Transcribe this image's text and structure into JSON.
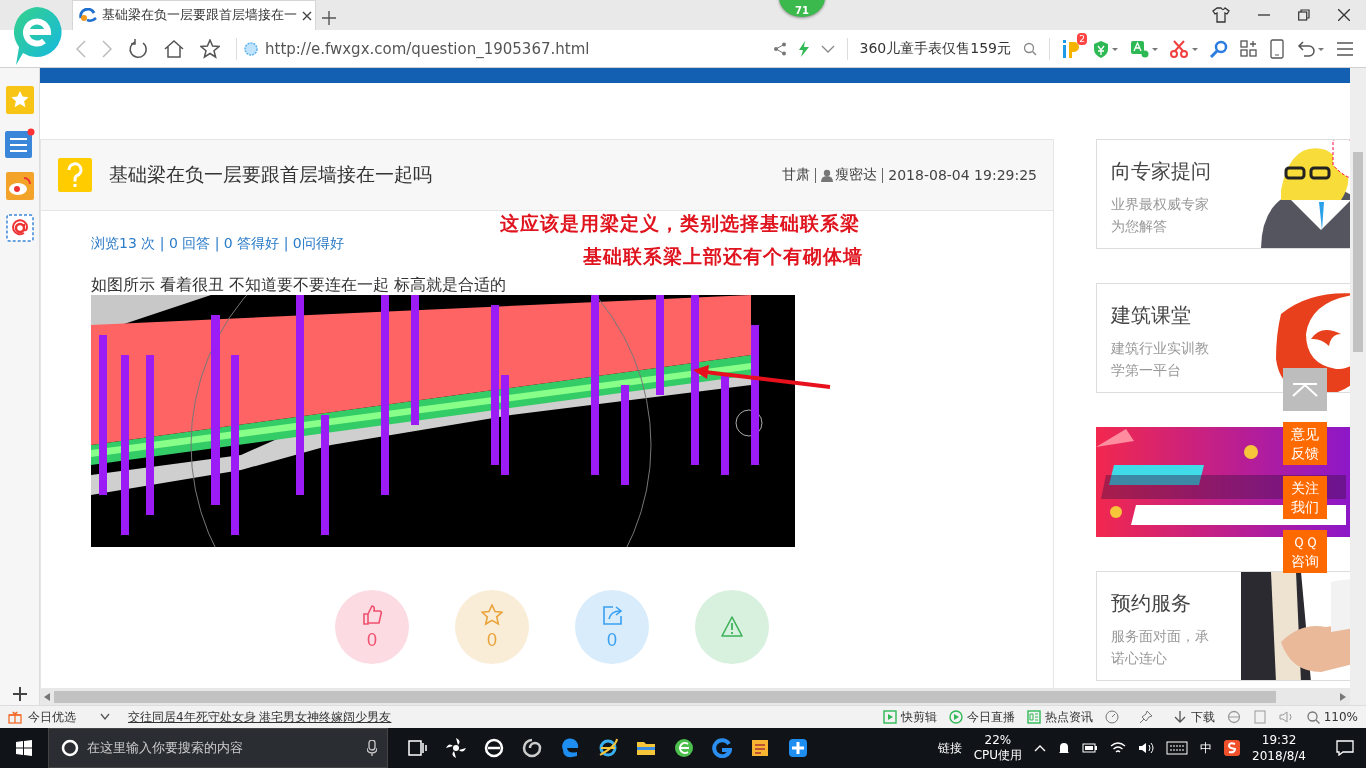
{
  "browser": {
    "tab": {
      "title": "基础梁在负一层要跟首层墙接在一",
      "selected": true
    },
    "badge": "71",
    "address": {
      "url": "http://e.fwxgx.com/question_1905367.html"
    },
    "search": {
      "placeholder": "360儿童手表仅售159元"
    },
    "plugin_badge": "2"
  },
  "question": {
    "title": "基础梁在负一层要跟首层墙接在一起吗",
    "location": "甘肃",
    "author": "瘦密达",
    "date": "2018-08-04 19:29:25",
    "stats": "浏览13 次 | 0 回答 | 0 答得好 | 0问得好",
    "annotations": [
      "这应该是用梁定义，类别选择基础联系梁",
      "基础联系梁上部还有个有砌体墙"
    ],
    "body": "如图所示 看着很丑 不知道要不要连在一起 标高就是合适的",
    "actions": [
      {
        "kind": "like",
        "count": "0",
        "color": "#f0506e"
      },
      {
        "kind": "favorite",
        "count": "0",
        "color": "#e8a33a"
      },
      {
        "kind": "share",
        "count": "0",
        "color": "#3aa0f0"
      },
      {
        "kind": "report",
        "color": "#3cb35a"
      }
    ]
  },
  "right_cards": [
    {
      "kind": "mascot",
      "title": "向专家提问",
      "description": "业界最权威专家为您解答"
    },
    {
      "kind": "logo",
      "title": "建筑课堂",
      "description": "建筑行业实训教学第一平台"
    },
    {
      "kind": "banner"
    },
    {
      "kind": "handshake",
      "title": "预约服务",
      "description": "服务面对面，承诺心连心"
    }
  ],
  "float_buttons": [
    {
      "kind": "top"
    },
    {
      "kind": "text",
      "label": "意见反馈"
    },
    {
      "kind": "text",
      "label": "关注我们"
    },
    {
      "kind": "text",
      "label": "ＱＱ咨询"
    }
  ],
  "status_bar": {
    "left": "今日优选",
    "news": "交往同居4年死守处女身 港宅男女神终嫁阔少男友",
    "items": [
      {
        "kind": "clip",
        "label": "快剪辑"
      },
      {
        "kind": "live",
        "label": "今日直播"
      },
      {
        "kind": "news",
        "label": "热点资讯"
      },
      {
        "kind": "download",
        "label": "下载"
      }
    ],
    "zoom": "110%"
  },
  "taskbar": {
    "search": {
      "placeholder": "在这里输入你要搜索的内容"
    },
    "link": "链接",
    "cpu": {
      "value": "22%",
      "label": "CPU使用"
    },
    "ime": "中",
    "time": "19:32",
    "date": "2018/8/4"
  }
}
